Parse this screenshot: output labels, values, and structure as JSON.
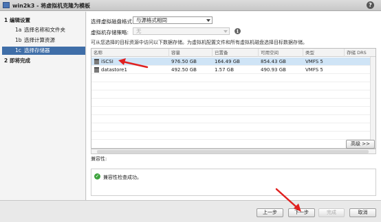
{
  "window": {
    "title": "win2k3 - 将虚拟机克隆为模板",
    "help_symbol": "?"
  },
  "sidebar": {
    "steps": [
      {
        "num": "1",
        "label": "编辑设置"
      },
      {
        "num": "1a",
        "label": "选择名称和文件夹"
      },
      {
        "num": "1b",
        "label": "选择计算资源"
      },
      {
        "num": "1c",
        "label": "选择存储器"
      },
      {
        "num": "2",
        "label": "即将完成"
      }
    ]
  },
  "form": {
    "disk_format_label": "选择虚拟磁盘格式:",
    "disk_format_value": "与源格式相同",
    "storage_policy_label": "虚拟机存储策略:",
    "storage_policy_value": "无",
    "info_symbol": "i",
    "hint": "可从您选择的目标资源中访问以下数据存储。为虚拟机配置文件和所有虚拟机磁盘选择目标数据存储。"
  },
  "table": {
    "columns": [
      "名称",
      "容量",
      "已置备",
      "可用空间",
      "类型",
      "存储 DRS"
    ],
    "rows": [
      {
        "name": "iSCSI",
        "capacity": "976.50 GB",
        "provisioned": "164.49 GB",
        "free": "854.43 GB",
        "type": "VMFS 5",
        "drs": "",
        "selected": true
      },
      {
        "name": "datastore1",
        "capacity": "492.50 GB",
        "provisioned": "1.57 GB",
        "free": "490.93 GB",
        "type": "VMFS 5",
        "drs": "",
        "selected": false
      }
    ]
  },
  "advanced_button": "高级 >>",
  "compatibility": {
    "title": "兼容性:",
    "message": "兼容性检查成功。",
    "status_symbol": "✓"
  },
  "footer": {
    "back": "上一步",
    "next": "下一步",
    "finish": "完成",
    "cancel": "取消"
  },
  "colors": {
    "accent": "#3f6ea8",
    "selection": "#cfe4f6",
    "annotation_arrow": "#e0201f",
    "success": "#3ea33e"
  }
}
